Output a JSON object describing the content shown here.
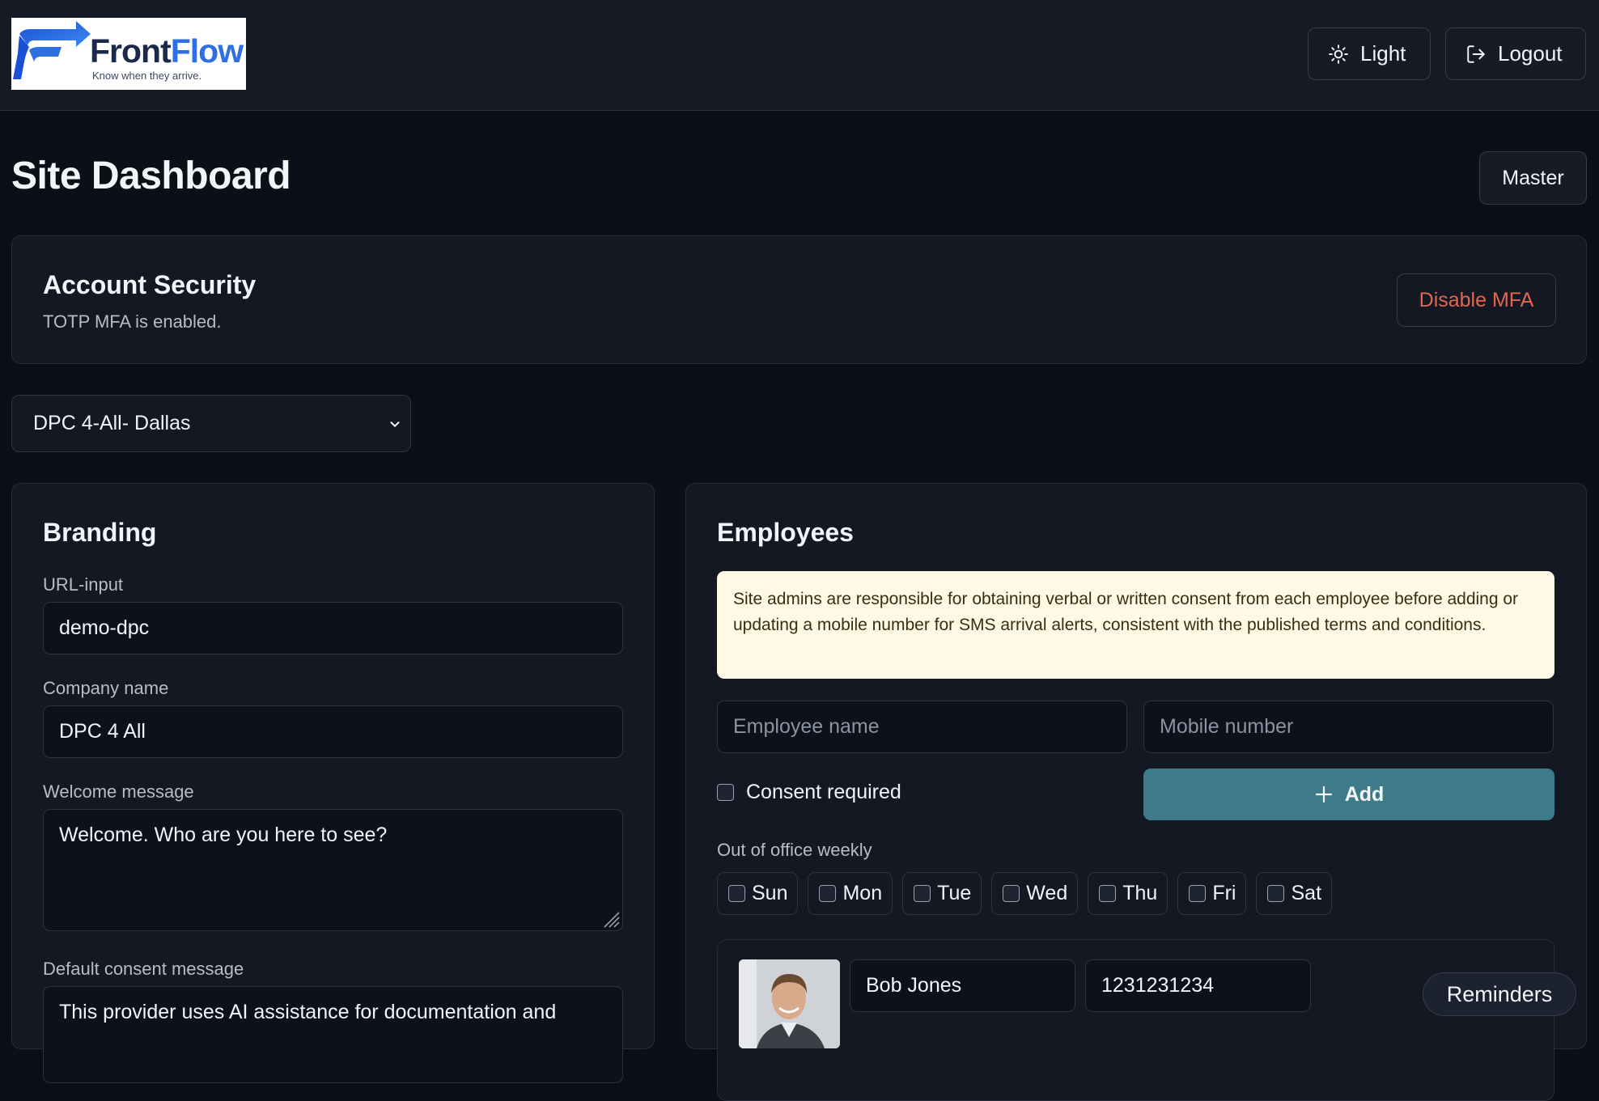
{
  "header": {
    "logo": {
      "name": "FrontFlow",
      "name_part1": "Front",
      "name_part2": "Flow",
      "tagline": "Know when they arrive."
    },
    "theme_label": "Light",
    "logout_label": "Logout"
  },
  "page": {
    "title": "Site Dashboard",
    "master_label": "Master"
  },
  "security": {
    "title": "Account Security",
    "subtitle": "TOTP MFA is enabled.",
    "disable_label": "Disable MFA"
  },
  "site_select": {
    "value": "DPC 4-All- Dallas"
  },
  "branding": {
    "title": "Branding",
    "url_label": "URL-input",
    "url_value": "demo-dpc",
    "company_label": "Company name",
    "company_value": "DPC 4 All",
    "welcome_label": "Welcome message",
    "welcome_value": "Welcome. Who are you here to see?",
    "consent_label": "Default consent message",
    "consent_value": "This provider uses AI assistance for documentation and"
  },
  "employees": {
    "title": "Employees",
    "notice": "Site admins are responsible for obtaining verbal or written consent from each employee before adding or updating a mobile number for SMS arrival alerts, consistent with the published terms and conditions.",
    "name_placeholder": "Employee name",
    "mobile_placeholder": "Mobile number",
    "consent_label": "Consent required",
    "add_label": "Add",
    "ooo_label": "Out of office weekly",
    "days": [
      "Sun",
      "Mon",
      "Tue",
      "Wed",
      "Thu",
      "Fri",
      "Sat"
    ],
    "list": [
      {
        "name": "Bob Jones",
        "mobile": "1231231234"
      }
    ]
  },
  "reminders_label": "Reminders",
  "colors": {
    "background": "#0b0f17",
    "card": "#131822",
    "accent_button": "#3d7b8b",
    "danger_text": "#e4664f",
    "notice_bg": "#fef9e4",
    "logo_blue": "#2f6fe0"
  },
  "icons": [
    "frontflow-logo-icon",
    "sun-icon",
    "logout-icon",
    "chevron-down-icon",
    "plus-icon",
    "resize-grip-icon",
    "avatar-photo"
  ]
}
